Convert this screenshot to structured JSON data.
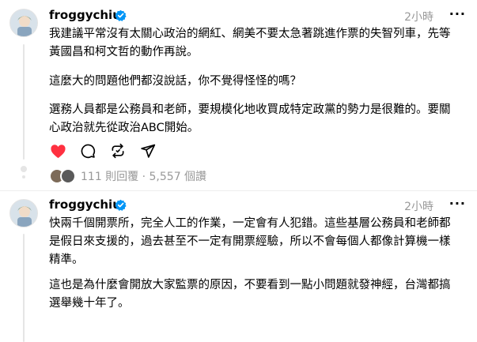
{
  "posts": [
    {
      "username": "froggychiu",
      "time": "2小時",
      "more_label": "···",
      "paragraphs": [
        "我建議平常沒有太關心政治的網紅、網美不要太急著跳進作票的失智列車，先等黃國昌和柯文哲的動作再說。",
        "這麼大的問題他們都沒說話，你不覺得怪怪的嗎？",
        "選務人員都是公務員和老師，要規模化地收買成特定政黨的勢力是很難的。要關心政治就先從政治ABC開始。"
      ],
      "stats": "111 則回覆 · 5,557 個讚"
    },
    {
      "username": "froggychiu",
      "time": "2小時",
      "more_label": "···",
      "paragraphs": [
        "快兩千個開票所，完全人工的作業，一定會有人犯錯。這些基層公務員和老師都是假日來支援的，過去甚至不一定有開票經驗，所以不會每個人都像計算機一樣精準。",
        "這也是為什麼會開放大家監票的原因，不要看到一點小問題就發神經，台灣都搞選舉幾十年了。"
      ]
    }
  ],
  "colors": {
    "like": "#ff3040",
    "verified": "#0095f6",
    "muted": "#999999"
  },
  "icons": [
    "heart-icon",
    "comment-icon",
    "repost-icon",
    "share-icon",
    "verified-icon"
  ]
}
